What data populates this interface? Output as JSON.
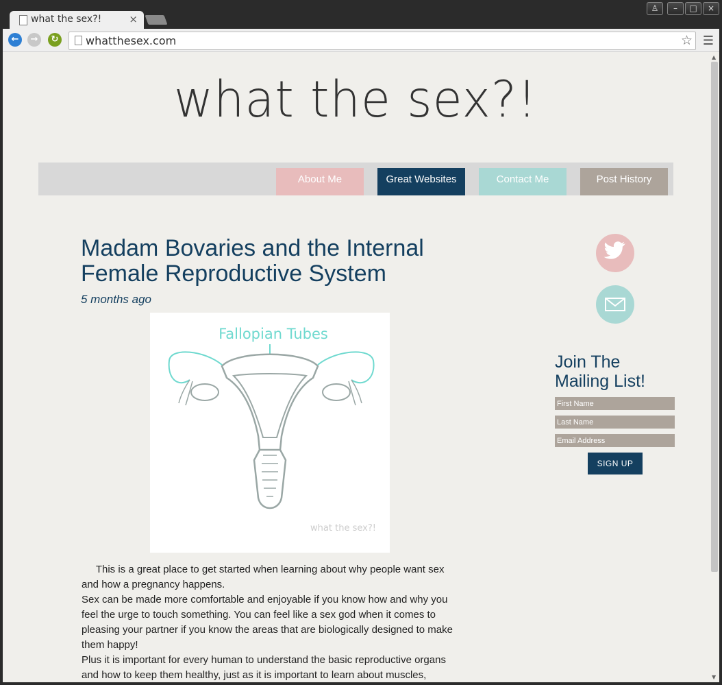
{
  "browser": {
    "tab_title": "what the sex?!",
    "tab_close": "×",
    "url": "whatthesex.com",
    "window_buttons": [
      "♙",
      "–",
      "□",
      "×"
    ]
  },
  "site": {
    "logo": "what the sex?!",
    "nav": [
      {
        "label": "About Me",
        "color": "#e8bcbc"
      },
      {
        "label": "Great Websites",
        "color": "#143f5f"
      },
      {
        "label": "Contact Me",
        "color": "#a9d8d4"
      },
      {
        "label": "Post History",
        "color": "#ada49b"
      }
    ]
  },
  "post": {
    "title": "Madam Bovaries and the Internal Female Reproductive System",
    "date": "5 months ago",
    "image_caption": "Fallopian Tubes",
    "image_watermark": "what the sex?!",
    "paragraphs": [
      "     This is a great place to get started when learning about why people want sex and how a pregnancy happens.",
      "Sex can be made more comfortable and enjoyable if you know how and why you feel the urge to touch something. You can feel like a sex god when it comes to pleasing your partner if you know the areas that are biologically designed to make them happy!",
      "Plus it is important for every human to understand the basic reproductive organs and how to keep them healthy, just as it is important to learn about muscles,"
    ]
  },
  "sidebar": {
    "twitter_color": "#e8bcbc",
    "email_color": "#a9d8d4",
    "mailing_title_line1": "Join The",
    "mailing_title_line2": "Mailing List!",
    "first_name_placeholder": "First Name",
    "last_name_placeholder": "Last Name",
    "email_placeholder": "Email Address",
    "signup_label": "SIGN UP"
  }
}
